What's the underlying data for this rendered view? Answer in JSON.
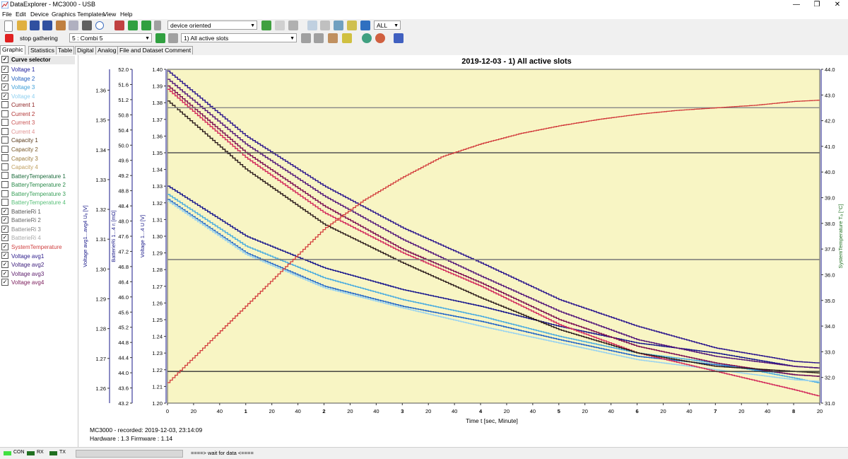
{
  "window": {
    "title": "DataExplorer  -  MC3000  -  USB",
    "minimize": "—",
    "maximize": "❐",
    "close": "✕"
  },
  "menu": [
    "File",
    "Edit",
    "Device",
    "Graphics Templates",
    "View",
    "Help"
  ],
  "toolbar": {
    "view_mode": "device oriented",
    "scope": "ALL",
    "stop_label": "stop gathering",
    "channel": "5 : Combi 5",
    "record": "1) All active slots"
  },
  "tabs": [
    "Graphic",
    "Statistics",
    "Table",
    "Digital",
    "Analog",
    "File and Dataset Comment"
  ],
  "curve_selector": {
    "header": "Curve selector",
    "items": [
      {
        "label": "Voltage 1",
        "checked": true,
        "color": "#1a1a9a"
      },
      {
        "label": "Voltage 2",
        "checked": true,
        "color": "#1f5fbf"
      },
      {
        "label": "Voltage 3",
        "checked": true,
        "color": "#3fa0d8"
      },
      {
        "label": "Voltage 4",
        "checked": true,
        "color": "#8fd0f0"
      },
      {
        "label": "Current 1",
        "checked": false,
        "color": "#8a1a1a"
      },
      {
        "label": "Current 2",
        "checked": false,
        "color": "#b03030"
      },
      {
        "label": "Current 3",
        "checked": false,
        "color": "#c85050"
      },
      {
        "label": "Current 4",
        "checked": false,
        "color": "#e09090"
      },
      {
        "label": "Capacity 1",
        "checked": false,
        "color": "#5a3a1a"
      },
      {
        "label": "Capacity 2",
        "checked": false,
        "color": "#7a5a2a"
      },
      {
        "label": "Capacity 3",
        "checked": false,
        "color": "#9a7a3a"
      },
      {
        "label": "Capacity 4",
        "checked": false,
        "color": "#c0a060"
      },
      {
        "label": "BatteryTemperature 1",
        "checked": false,
        "color": "#1a6a3a"
      },
      {
        "label": "BatteryTemperature 2",
        "checked": false,
        "color": "#2a8a4a"
      },
      {
        "label": "BatteryTemperature 3",
        "checked": false,
        "color": "#3aa05a"
      },
      {
        "label": "BatteryTemperature 4",
        "checked": false,
        "color": "#5ac07a"
      },
      {
        "label": "BatterieRi 1",
        "checked": true,
        "color": "#555555"
      },
      {
        "label": "BatterieRi 2",
        "checked": true,
        "color": "#666666"
      },
      {
        "label": "BatterieRi 3",
        "checked": true,
        "color": "#888888"
      },
      {
        "label": "BatterieRi 4",
        "checked": true,
        "color": "#aaaaaa"
      },
      {
        "label": "SystemTemperature",
        "checked": true,
        "color": "#d04040"
      },
      {
        "label": "Voltage avg1",
        "checked": true,
        "color": "#2a1a8a"
      },
      {
        "label": "Voltage avg2",
        "checked": true,
        "color": "#3a1a7a"
      },
      {
        "label": "Voltage avg3",
        "checked": true,
        "color": "#5a1a6a"
      },
      {
        "label": "Voltage avg4",
        "checked": true,
        "color": "#7a1a5a"
      }
    ]
  },
  "info": {
    "recorded": "MC3000 - recorded: 2019-12-03, 23:14:09",
    "firmware": "Hardware : 1.3 Firmware : 1.14"
  },
  "status": {
    "con": "CON",
    "rx": "RX",
    "tx": "TX",
    "message": "====> wait for data <===="
  },
  "chart_data": {
    "type": "line",
    "title": "2019-12-03 - 1) All active slots",
    "xlabel": "Time  t  [sec, Minute]",
    "x_tick_labels": [
      "0",
      "20",
      "40",
      "1",
      "20",
      "40",
      "2",
      "20",
      "40",
      "3",
      "20",
      "40",
      "4",
      "20",
      "40",
      "5",
      "20",
      "40",
      "6",
      "20",
      "40",
      "7",
      "20",
      "40",
      "8",
      "20"
    ],
    "x_major_labels": [
      "1",
      "2",
      "3",
      "4",
      "5",
      "6",
      "7",
      "8"
    ],
    "xlim": [
      0,
      8.33
    ],
    "axes": {
      "avg_voltage": {
        "label": "Voltage avg1...avg4  Uₐ  [V]",
        "ticks": [
          "1.36",
          "1.35",
          "1.34",
          "1.33",
          "1.32",
          "1.31",
          "1.30",
          "1.29",
          "1.28",
          "1.27",
          "1.26"
        ],
        "range": [
          1.255,
          1.367
        ]
      },
      "ri": {
        "label": "BatterieRi 1...4  rᵢ  [mΩ]",
        "ticks": [
          "52.0",
          "51.6",
          "51.2",
          "50.8",
          "50.4",
          "50.0",
          "49.6",
          "49.2",
          "48.8",
          "48.4",
          "48.0",
          "47.6",
          "47.2",
          "46.8",
          "46.4",
          "46.0",
          "45.6",
          "45.2",
          "44.8",
          "44.4",
          "44.0",
          "43.6",
          "43.2"
        ],
        "range": [
          43.2,
          52.0
        ]
      },
      "voltage": {
        "label": "Voltage 1...4  U  [V]",
        "ticks": [
          "1.40",
          "1.39",
          "1.38",
          "1.37",
          "1.36",
          "1.35",
          "1.34",
          "1.33",
          "1.32",
          "1.31",
          "1.30",
          "1.29",
          "1.28",
          "1.27",
          "1.26",
          "1.25",
          "1.24",
          "1.23",
          "1.22",
          "1.21",
          "1.20"
        ],
        "range": [
          1.2,
          1.4
        ]
      },
      "temperature": {
        "label": "SystemTemperature  Tₐ  [°C]",
        "ticks": [
          "44.0",
          "43.0",
          "42.0",
          "41.0",
          "40.0",
          "39.0",
          "38.0",
          "37.0",
          "36.0",
          "35.0",
          "34.0",
          "33.0",
          "32.0",
          "31.0"
        ],
        "range": [
          31.0,
          44.0
        ]
      }
    },
    "series": [
      {
        "name": "Voltage 1",
        "axis": "voltage",
        "color": "#14148c",
        "x": [
          0,
          1,
          2,
          3,
          4,
          5,
          6,
          7,
          8,
          8.33
        ],
        "y": [
          1.33,
          1.3,
          1.281,
          1.268,
          1.258,
          1.246,
          1.236,
          1.23,
          1.222,
          1.221
        ]
      },
      {
        "name": "Voltage 2",
        "axis": "voltage",
        "color": "#1e64c8",
        "x": [
          0,
          1,
          2,
          3,
          4,
          5,
          6,
          7,
          8,
          8.33
        ],
        "y": [
          1.322,
          1.29,
          1.27,
          1.258,
          1.249,
          1.238,
          1.228,
          1.223,
          1.217,
          1.216
        ]
      },
      {
        "name": "Voltage 3",
        "axis": "voltage",
        "color": "#46aae0",
        "x": [
          0,
          1,
          2,
          3,
          4,
          5,
          6,
          7,
          8,
          8.33
        ],
        "y": [
          1.325,
          1.294,
          1.275,
          1.262,
          1.252,
          1.24,
          1.23,
          1.224,
          1.215,
          1.212
        ]
      },
      {
        "name": "Voltage 4",
        "axis": "voltage",
        "color": "#96d2f0",
        "x": [
          0,
          1,
          2,
          3,
          4,
          5,
          6,
          7,
          8,
          8.33
        ],
        "y": [
          1.321,
          1.289,
          1.269,
          1.257,
          1.246,
          1.236,
          1.226,
          1.22,
          1.214,
          1.213
        ]
      },
      {
        "name": "Voltage avg1",
        "axis": "voltage",
        "color": "#2a148c",
        "x": [
          0,
          1,
          2,
          3,
          4,
          5,
          6,
          7,
          8,
          8.33
        ],
        "y": [
          1.399,
          1.36,
          1.33,
          1.305,
          1.284,
          1.262,
          1.246,
          1.233,
          1.225,
          1.224
        ]
      },
      {
        "name": "Voltage avg2",
        "axis": "voltage",
        "color": "#501478",
        "x": [
          0,
          1,
          2,
          3,
          4,
          5,
          6,
          7,
          8,
          8.33
        ],
        "y": [
          1.394,
          1.355,
          1.324,
          1.298,
          1.276,
          1.255,
          1.238,
          1.228,
          1.222,
          1.221
        ]
      },
      {
        "name": "Voltage avg3",
        "axis": "voltage",
        "color": "#d2285a",
        "x": [
          0,
          1,
          2,
          3,
          4,
          5,
          6,
          7,
          8,
          8.33
        ],
        "y": [
          1.388,
          1.347,
          1.314,
          1.29,
          1.27,
          1.247,
          1.23,
          1.219,
          1.208,
          1.204
        ]
      },
      {
        "name": "Voltage avg4",
        "axis": "voltage",
        "color": "#780a50",
        "x": [
          0,
          1,
          2,
          3,
          4,
          5,
          6,
          7,
          8,
          8.33
        ],
        "y": [
          1.39,
          1.35,
          1.318,
          1.292,
          1.272,
          1.25,
          1.234,
          1.224,
          1.217,
          1.216
        ]
      },
      {
        "name": "BatterieRi 1",
        "axis": "voltage",
        "color": "#2a1a1a",
        "x": [
          0,
          1,
          2,
          3,
          4,
          5,
          6,
          7,
          8,
          8.33
        ],
        "y": [
          1.381,
          1.34,
          1.307,
          1.284,
          1.263,
          1.244,
          1.23,
          1.222,
          1.219,
          1.218
        ]
      },
      {
        "name": "BatterieRi 2",
        "axis": "voltage",
        "color": "#555555",
        "x": [
          0,
          8.33
        ],
        "y": [
          1.35,
          1.35
        ]
      },
      {
        "name": "BatterieRi 3",
        "axis": "voltage",
        "color": "#888888",
        "x": [
          0,
          8.33
        ],
        "y": [
          1.377,
          1.377
        ]
      },
      {
        "name": "BatterieRi 4",
        "axis": "voltage",
        "color": "#777777",
        "x": [
          0,
          8.33
        ],
        "y": [
          1.286,
          1.286
        ]
      },
      {
        "name": "BatterieRi line",
        "axis": "voltage",
        "color": "#333333",
        "x": [
          0,
          8.33
        ],
        "y": [
          1.219,
          1.219
        ]
      },
      {
        "name": "SystemTemperature",
        "axis": "temperature",
        "color": "#d23c3c",
        "x": [
          0,
          0.5,
          1,
          1.5,
          2,
          2.5,
          3,
          3.5,
          4,
          4.5,
          5,
          5.5,
          6,
          6.5,
          7,
          7.5,
          8,
          8.33
        ],
        "y": [
          31.8,
          33.3,
          34.8,
          36.3,
          37.8,
          38.9,
          39.8,
          40.6,
          41.1,
          41.5,
          41.8,
          42.05,
          42.25,
          42.4,
          42.5,
          42.6,
          42.75,
          42.8
        ]
      }
    ],
    "grid": false
  }
}
